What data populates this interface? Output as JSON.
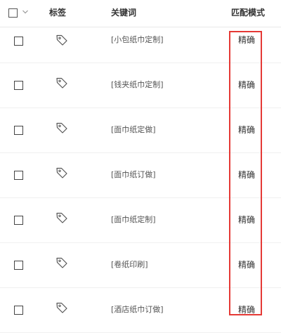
{
  "header": {
    "col_tag": "标签",
    "col_keyword": "关键词",
    "col_match_mode": "匹配模式"
  },
  "rows": [
    {
      "keyword": "[小包纸巾定制]",
      "match_mode": "精确"
    },
    {
      "keyword": "[钱夹纸巾定制]",
      "match_mode": "精确"
    },
    {
      "keyword": "[面巾纸定做]",
      "match_mode": "精确"
    },
    {
      "keyword": "[面巾纸订做]",
      "match_mode": "精确"
    },
    {
      "keyword": "[面巾纸定制]",
      "match_mode": "精确"
    },
    {
      "keyword": "[卷纸印刷]",
      "match_mode": "精确"
    },
    {
      "keyword": "[酒店纸巾订做]",
      "match_mode": "精确"
    }
  ],
  "colors": {
    "highlight": "#e53935",
    "border": "#e8e8e8",
    "text": "#333333"
  },
  "icons": {
    "tag": "tag-icon",
    "caret": "chevron-down-icon"
  }
}
